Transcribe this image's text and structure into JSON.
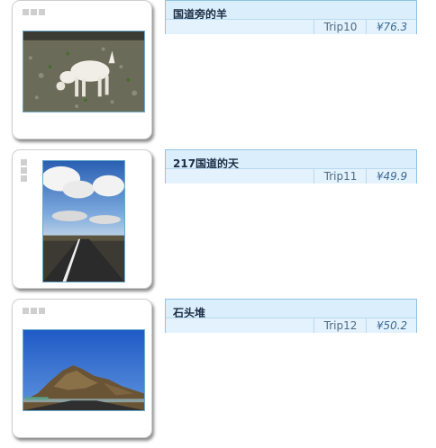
{
  "items": [
    {
      "title": "国道旁的羊",
      "trip": "Trip10",
      "price": "¥76.3",
      "photo_subject": "white goat grazing on rocky grassland"
    },
    {
      "title": "217国道的天",
      "trip": "Trip11",
      "price": "¥49.9",
      "photo_subject": "road stretching toward cloudy blue sky"
    },
    {
      "title": "石头堆",
      "trip": "Trip12",
      "price": "¥50.2",
      "photo_subject": "rocky hill under blue sky"
    }
  ],
  "colors": {
    "panel_bg": "#dbeefc",
    "panel_border": "#8fc3e6",
    "handle": "#cfcfcf"
  },
  "icons": {
    "drag_handle": "drag-handle-icon"
  }
}
